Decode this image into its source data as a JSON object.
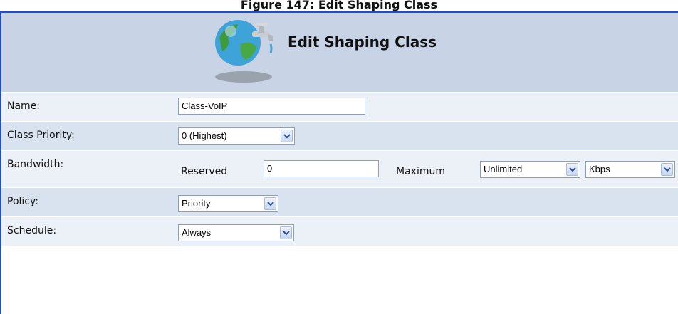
{
  "caption": "Figure 147: Edit Shaping Class",
  "header": {
    "title": "Edit Shaping Class"
  },
  "rows": {
    "name": {
      "label": "Name:",
      "value": "Class-VoIP"
    },
    "priority": {
      "label": "Class Priority:",
      "value": "0 (Highest)"
    },
    "bandwidth": {
      "label": "Bandwidth:",
      "reserved_label": "Reserved",
      "reserved_value": "0",
      "maximum_label": "Maximum",
      "maximum_value": "Unlimited",
      "unit_value": "Kbps"
    },
    "policy": {
      "label": "Policy:",
      "value": "Priority"
    },
    "schedule": {
      "label": "Schedule:",
      "value": "Always"
    }
  },
  "colors": {
    "frame": "#1a4fd0",
    "header_bg": "#c8d4e6",
    "row_bg": "#d9e2ef"
  },
  "icons": {
    "header": "globe-faucet-icon",
    "dropdown": "chevron-down-icon"
  }
}
